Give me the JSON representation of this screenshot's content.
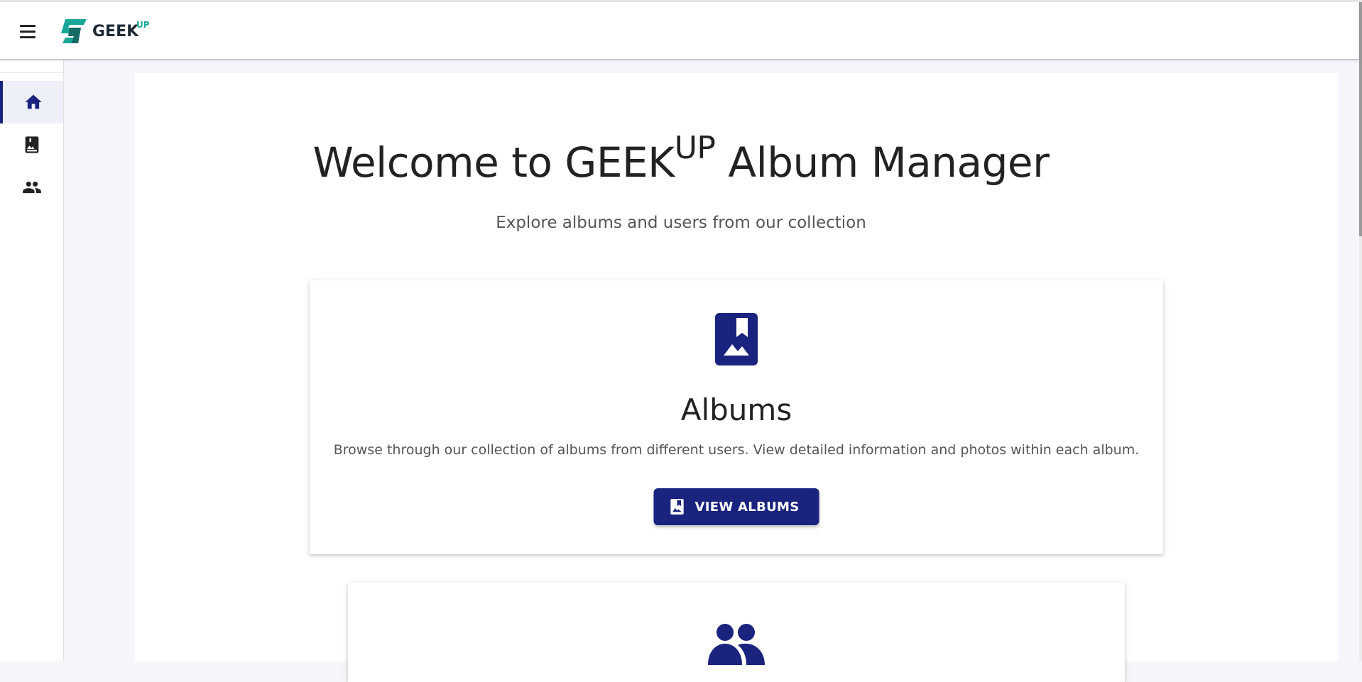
{
  "header": {
    "menu_icon": "menu-icon",
    "logo_text": "GEEK",
    "logo_sup": "UP",
    "logo_accent": "#1aa79a"
  },
  "sidebar": {
    "items": [
      {
        "icon": "home-icon",
        "active": true
      },
      {
        "icon": "album-icon",
        "active": false
      },
      {
        "icon": "users-icon",
        "active": false
      }
    ],
    "active_color": "#1a237e"
  },
  "main": {
    "title_prefix": "Welcome to GEEK",
    "title_sup": "UP",
    "title_suffix": " Album Manager",
    "subtitle": "Explore albums and users from our collection",
    "cards": [
      {
        "icon": "album-icon",
        "title": "Albums",
        "description": "Browse through our collection of albums from different users. View detailed information and photos within each album.",
        "button_label": "VIEW ALBUMS",
        "button_icon": "album-icon"
      },
      {
        "icon": "users-icon"
      }
    ]
  },
  "colors": {
    "primary": "#1a237e",
    "background": "#f5f6fa"
  }
}
